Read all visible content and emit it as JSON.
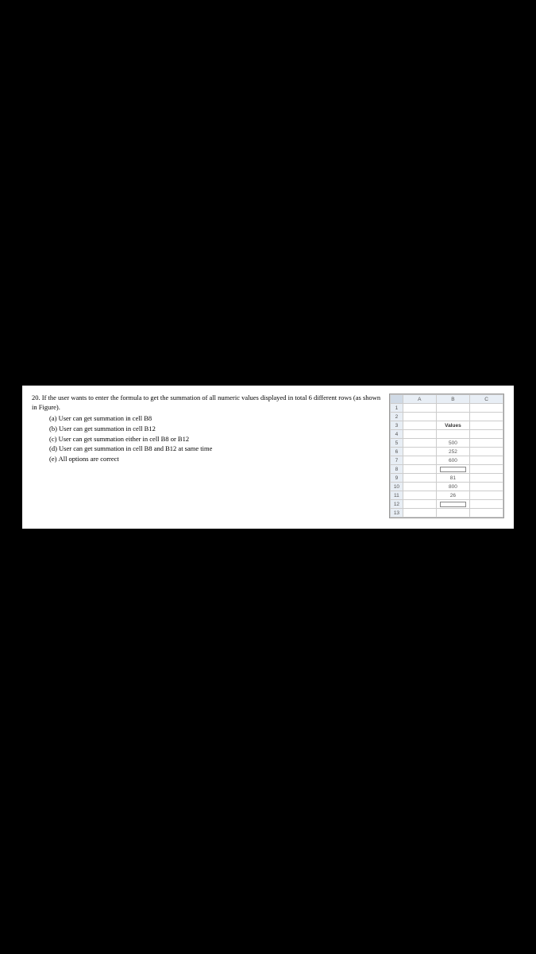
{
  "question": {
    "number": "20.",
    "text": "If the user wants to enter the formula to get the summation of all numeric values displayed in total 6 different rows (as shown in Figure).",
    "options": [
      {
        "letter": "(a)",
        "text": "User can get summation in cell B8"
      },
      {
        "letter": "(b)",
        "text": "User can get summation in cell B12"
      },
      {
        "letter": "(c)",
        "text": "User can get summation either in cell B8 or B12"
      },
      {
        "letter": "(d)",
        "text": "User can get summation in cell B8 and B12 at same time"
      },
      {
        "letter": "(e)",
        "text": "All options are correct"
      }
    ]
  },
  "spreadsheet": {
    "columns": [
      "A",
      "B",
      "C"
    ],
    "heading_label": "Values",
    "rows": [
      {
        "num": "1",
        "b": ""
      },
      {
        "num": "2",
        "b": ""
      },
      {
        "num": "3",
        "b": "Values",
        "heading": true
      },
      {
        "num": "4",
        "b": ""
      },
      {
        "num": "5",
        "b": "500"
      },
      {
        "num": "6",
        "b": "252"
      },
      {
        "num": "7",
        "b": "600"
      },
      {
        "num": "8",
        "b": "",
        "input": true
      },
      {
        "num": "9",
        "b": "81"
      },
      {
        "num": "10",
        "b": "800"
      },
      {
        "num": "11",
        "b": "26"
      },
      {
        "num": "12",
        "b": "",
        "input": true
      },
      {
        "num": "13",
        "b": ""
      }
    ]
  }
}
